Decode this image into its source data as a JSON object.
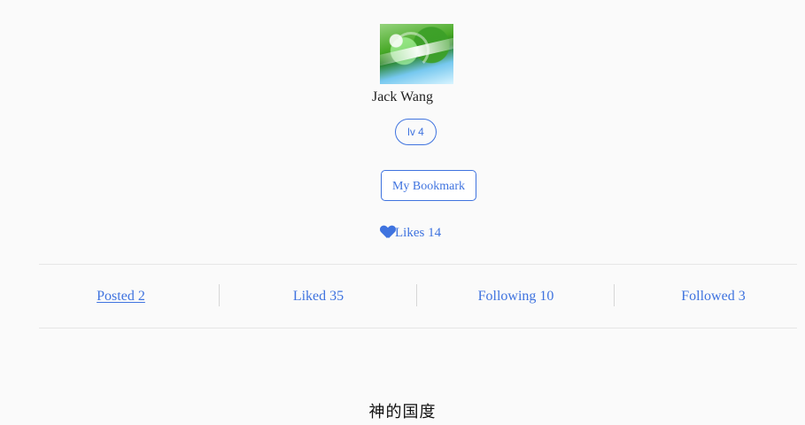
{
  "profile": {
    "name": "Jack Wang",
    "level": "lv 4",
    "bookmark_button": "My Bookmark",
    "likes": "Likes 14"
  },
  "stats": {
    "posted": "Posted 2",
    "liked": "Liked 35",
    "following": "Following 10",
    "followed": "Followed 3"
  },
  "footer": {
    "caption": "神的国度"
  },
  "colors": {
    "accent": "#3f73df",
    "page_background": "#fafafa",
    "divider": "#e6e6e6"
  },
  "icons": {
    "likes": "heart-icon"
  }
}
